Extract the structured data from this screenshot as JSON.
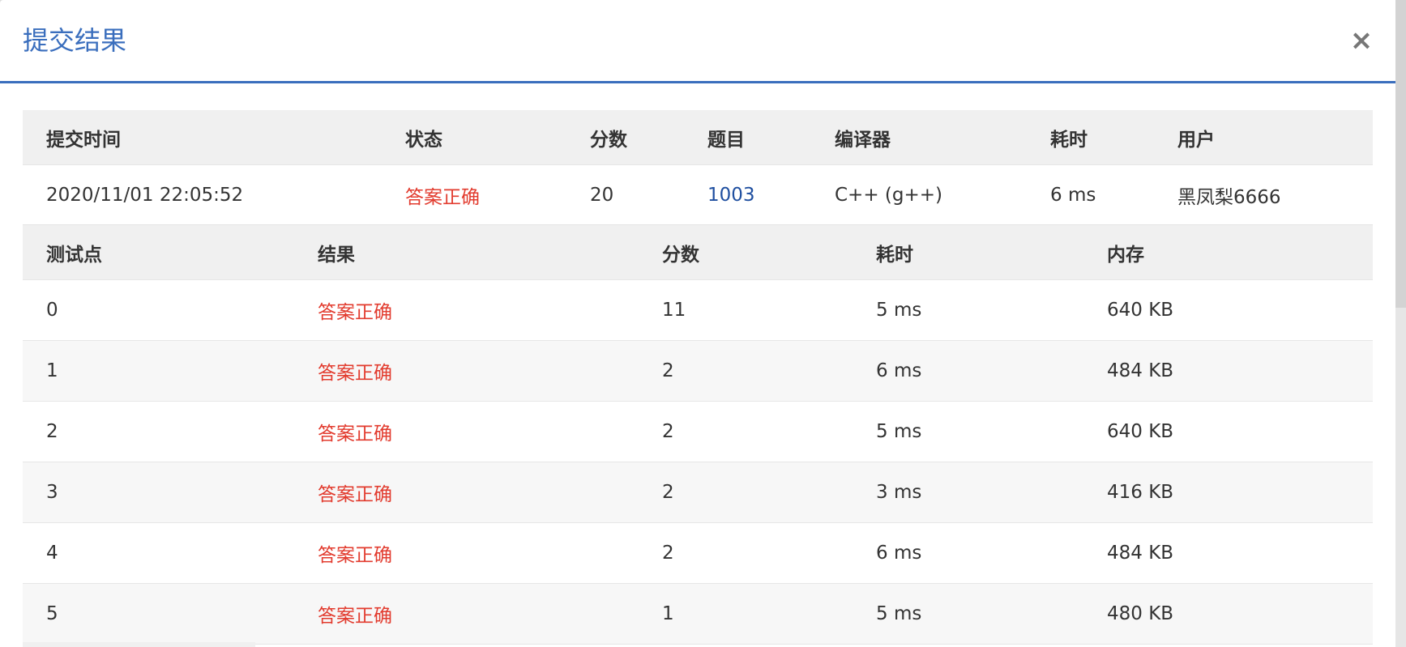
{
  "dialog": {
    "title": "提交结果",
    "close_symbol": "×"
  },
  "submission": {
    "headers": {
      "time": "提交时间",
      "status": "状态",
      "score": "分数",
      "problem": "题目",
      "compiler": "编译器",
      "duration": "耗时",
      "user": "用户"
    },
    "row": {
      "time": "2020/11/01 22:05:52",
      "status": "答案正确",
      "score": "20",
      "problem": "1003",
      "compiler": "C++ (g++)",
      "duration": "6 ms",
      "user": "黑凤梨6666"
    }
  },
  "tests": {
    "headers": {
      "case": "测试点",
      "result": "结果",
      "score": "分数",
      "duration": "耗时",
      "memory": "内存"
    },
    "rows": [
      {
        "case": "0",
        "result": "答案正确",
        "score": "11",
        "duration": "5 ms",
        "memory": "640 KB"
      },
      {
        "case": "1",
        "result": "答案正确",
        "score": "2",
        "duration": "6 ms",
        "memory": "484 KB"
      },
      {
        "case": "2",
        "result": "答案正确",
        "score": "2",
        "duration": "5 ms",
        "memory": "640 KB"
      },
      {
        "case": "3",
        "result": "答案正确",
        "score": "2",
        "duration": "3 ms",
        "memory": "416 KB"
      },
      {
        "case": "4",
        "result": "答案正确",
        "score": "2",
        "duration": "6 ms",
        "memory": "484 KB"
      },
      {
        "case": "5",
        "result": "答案正确",
        "score": "1",
        "duration": "5 ms",
        "memory": "480 KB"
      }
    ]
  },
  "colors": {
    "accent": "#3a6ebd",
    "accepted": "#e23b2e",
    "link": "#1f4fa0",
    "header_bg": "#f0f0f0"
  }
}
